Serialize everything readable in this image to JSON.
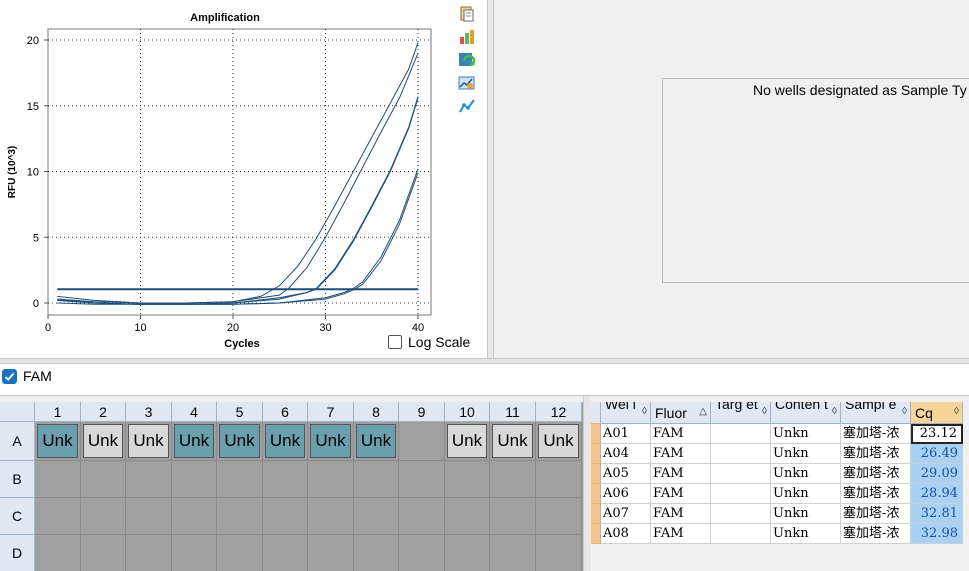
{
  "chart": {
    "title": "Amplification",
    "xlabel": "Cycles",
    "ylabel": "RFU (10^3)",
    "log_scale_label": "Log Scale",
    "log_scale_checked": false
  },
  "chart_data": {
    "type": "line",
    "title": "Amplification",
    "xlabel": "Cycles",
    "ylabel": "RFU (10^3)",
    "xlim": [
      0,
      40
    ],
    "ylim": [
      -0.5,
      20.5
    ],
    "xticks": [
      0,
      10,
      20,
      30,
      40
    ],
    "yticks": [
      0,
      5,
      10,
      15,
      20
    ],
    "grid": true,
    "line_color": "#1f4e79",
    "threshold": 1.05,
    "series": [
      {
        "well": "A01",
        "x": [
          1,
          5,
          10,
          15,
          20,
          23,
          25,
          27,
          29,
          31,
          33,
          35,
          37,
          39,
          40
        ],
        "y": [
          0.5,
          0.2,
          0.0,
          0.0,
          0.1,
          0.5,
          1.3,
          2.8,
          4.9,
          7.4,
          10.0,
          12.6,
          15.2,
          17.8,
          19.8
        ]
      },
      {
        "well": "A04",
        "x": [
          1,
          5,
          10,
          15,
          20,
          25,
          26,
          28,
          30,
          32,
          34,
          36,
          38,
          40
        ],
        "y": [
          0.3,
          0.1,
          0.0,
          0.0,
          0.1,
          0.6,
          1.1,
          2.7,
          5.0,
          7.6,
          10.3,
          13.0,
          15.6,
          19.0
        ]
      },
      {
        "well": "A05",
        "x": [
          1,
          5,
          10,
          15,
          20,
          25,
          28,
          29,
          31,
          33,
          35,
          37,
          39,
          40
        ],
        "y": [
          0.2,
          0.0,
          -0.1,
          -0.1,
          0.0,
          0.4,
          0.8,
          1.1,
          2.6,
          4.8,
          7.4,
          10.1,
          13.4,
          15.7
        ]
      },
      {
        "well": "A06",
        "x": [
          1,
          5,
          10,
          15,
          20,
          25,
          28,
          29,
          31,
          33,
          35,
          37,
          39,
          40
        ],
        "y": [
          0.2,
          0.0,
          -0.1,
          -0.1,
          0.0,
          0.3,
          0.8,
          1.05,
          2.5,
          4.7,
          7.3,
          10.0,
          13.3,
          15.6
        ]
      },
      {
        "well": "A07",
        "x": [
          1,
          5,
          10,
          15,
          20,
          25,
          30,
          32,
          33,
          34,
          36,
          38,
          40
        ],
        "y": [
          0.3,
          0.0,
          -0.1,
          -0.1,
          -0.1,
          0.0,
          0.4,
          0.8,
          1.1,
          1.6,
          3.5,
          6.3,
          10.2
        ]
      },
      {
        "well": "A08",
        "x": [
          1,
          5,
          10,
          15,
          20,
          25,
          30,
          32,
          33,
          34,
          36,
          38,
          40
        ],
        "y": [
          0.0,
          -0.1,
          -0.1,
          -0.1,
          -0.1,
          0.0,
          0.3,
          0.7,
          1.0,
          1.4,
          3.2,
          6.0,
          9.9
        ]
      }
    ]
  },
  "toolbar_icons": [
    "copy-icon",
    "export-chart-icon",
    "refresh-icon",
    "chart-settings-icon",
    "trace-icon"
  ],
  "message": "No wells designated as Sample Ty",
  "fluor_filter": {
    "label": "FAM",
    "checked": true
  },
  "plate": {
    "columns": [
      "1",
      "2",
      "3",
      "4",
      "5",
      "6",
      "7",
      "8",
      "9",
      "10",
      "11",
      "12"
    ],
    "rows": [
      "A",
      "B",
      "C",
      "D"
    ],
    "well_label": "Unk",
    "row_A": [
      {
        "content": "Unk",
        "state": "selected"
      },
      {
        "content": "Unk",
        "state": "unselected"
      },
      {
        "content": "Unk",
        "state": "unselected"
      },
      {
        "content": "Unk",
        "state": "selected"
      },
      {
        "content": "Unk",
        "state": "selected"
      },
      {
        "content": "Unk",
        "state": "selected"
      },
      {
        "content": "Unk",
        "state": "selected"
      },
      {
        "content": "Unk",
        "state": "selected"
      },
      {
        "content": "",
        "state": "empty"
      },
      {
        "content": "Unk",
        "state": "unselected"
      },
      {
        "content": "Unk",
        "state": "unselected"
      },
      {
        "content": "Unk",
        "state": "unselected"
      }
    ]
  },
  "results_table": {
    "headers": [
      "Wel l",
      "Fluor",
      "Targ et",
      "Conten t",
      "Sampl e",
      "Cq"
    ],
    "sort_icons": [
      "◊",
      "△",
      "◊",
      "◊",
      "◊",
      "◊"
    ],
    "rows": [
      {
        "well": "A01",
        "fluor": "FAM",
        "target": "",
        "content": "Unkn",
        "sample": "塞加塔-浓",
        "cq": "23.12"
      },
      {
        "well": "A04",
        "fluor": "FAM",
        "target": "",
        "content": "Unkn",
        "sample": "塞加塔-浓",
        "cq": "26.49"
      },
      {
        "well": "A05",
        "fluor": "FAM",
        "target": "",
        "content": "Unkn",
        "sample": "塞加塔-浓",
        "cq": "29.09"
      },
      {
        "well": "A06",
        "fluor": "FAM",
        "target": "",
        "content": "Unkn",
        "sample": "塞加塔-浓",
        "cq": "28.94"
      },
      {
        "well": "A07",
        "fluor": "FAM",
        "target": "",
        "content": "Unkn",
        "sample": "塞加塔-浓",
        "cq": "32.81"
      },
      {
        "well": "A08",
        "fluor": "FAM",
        "target": "",
        "content": "Unkn",
        "sample": "塞加塔-浓",
        "cq": "32.98"
      }
    ],
    "active_cq_row": 0
  }
}
